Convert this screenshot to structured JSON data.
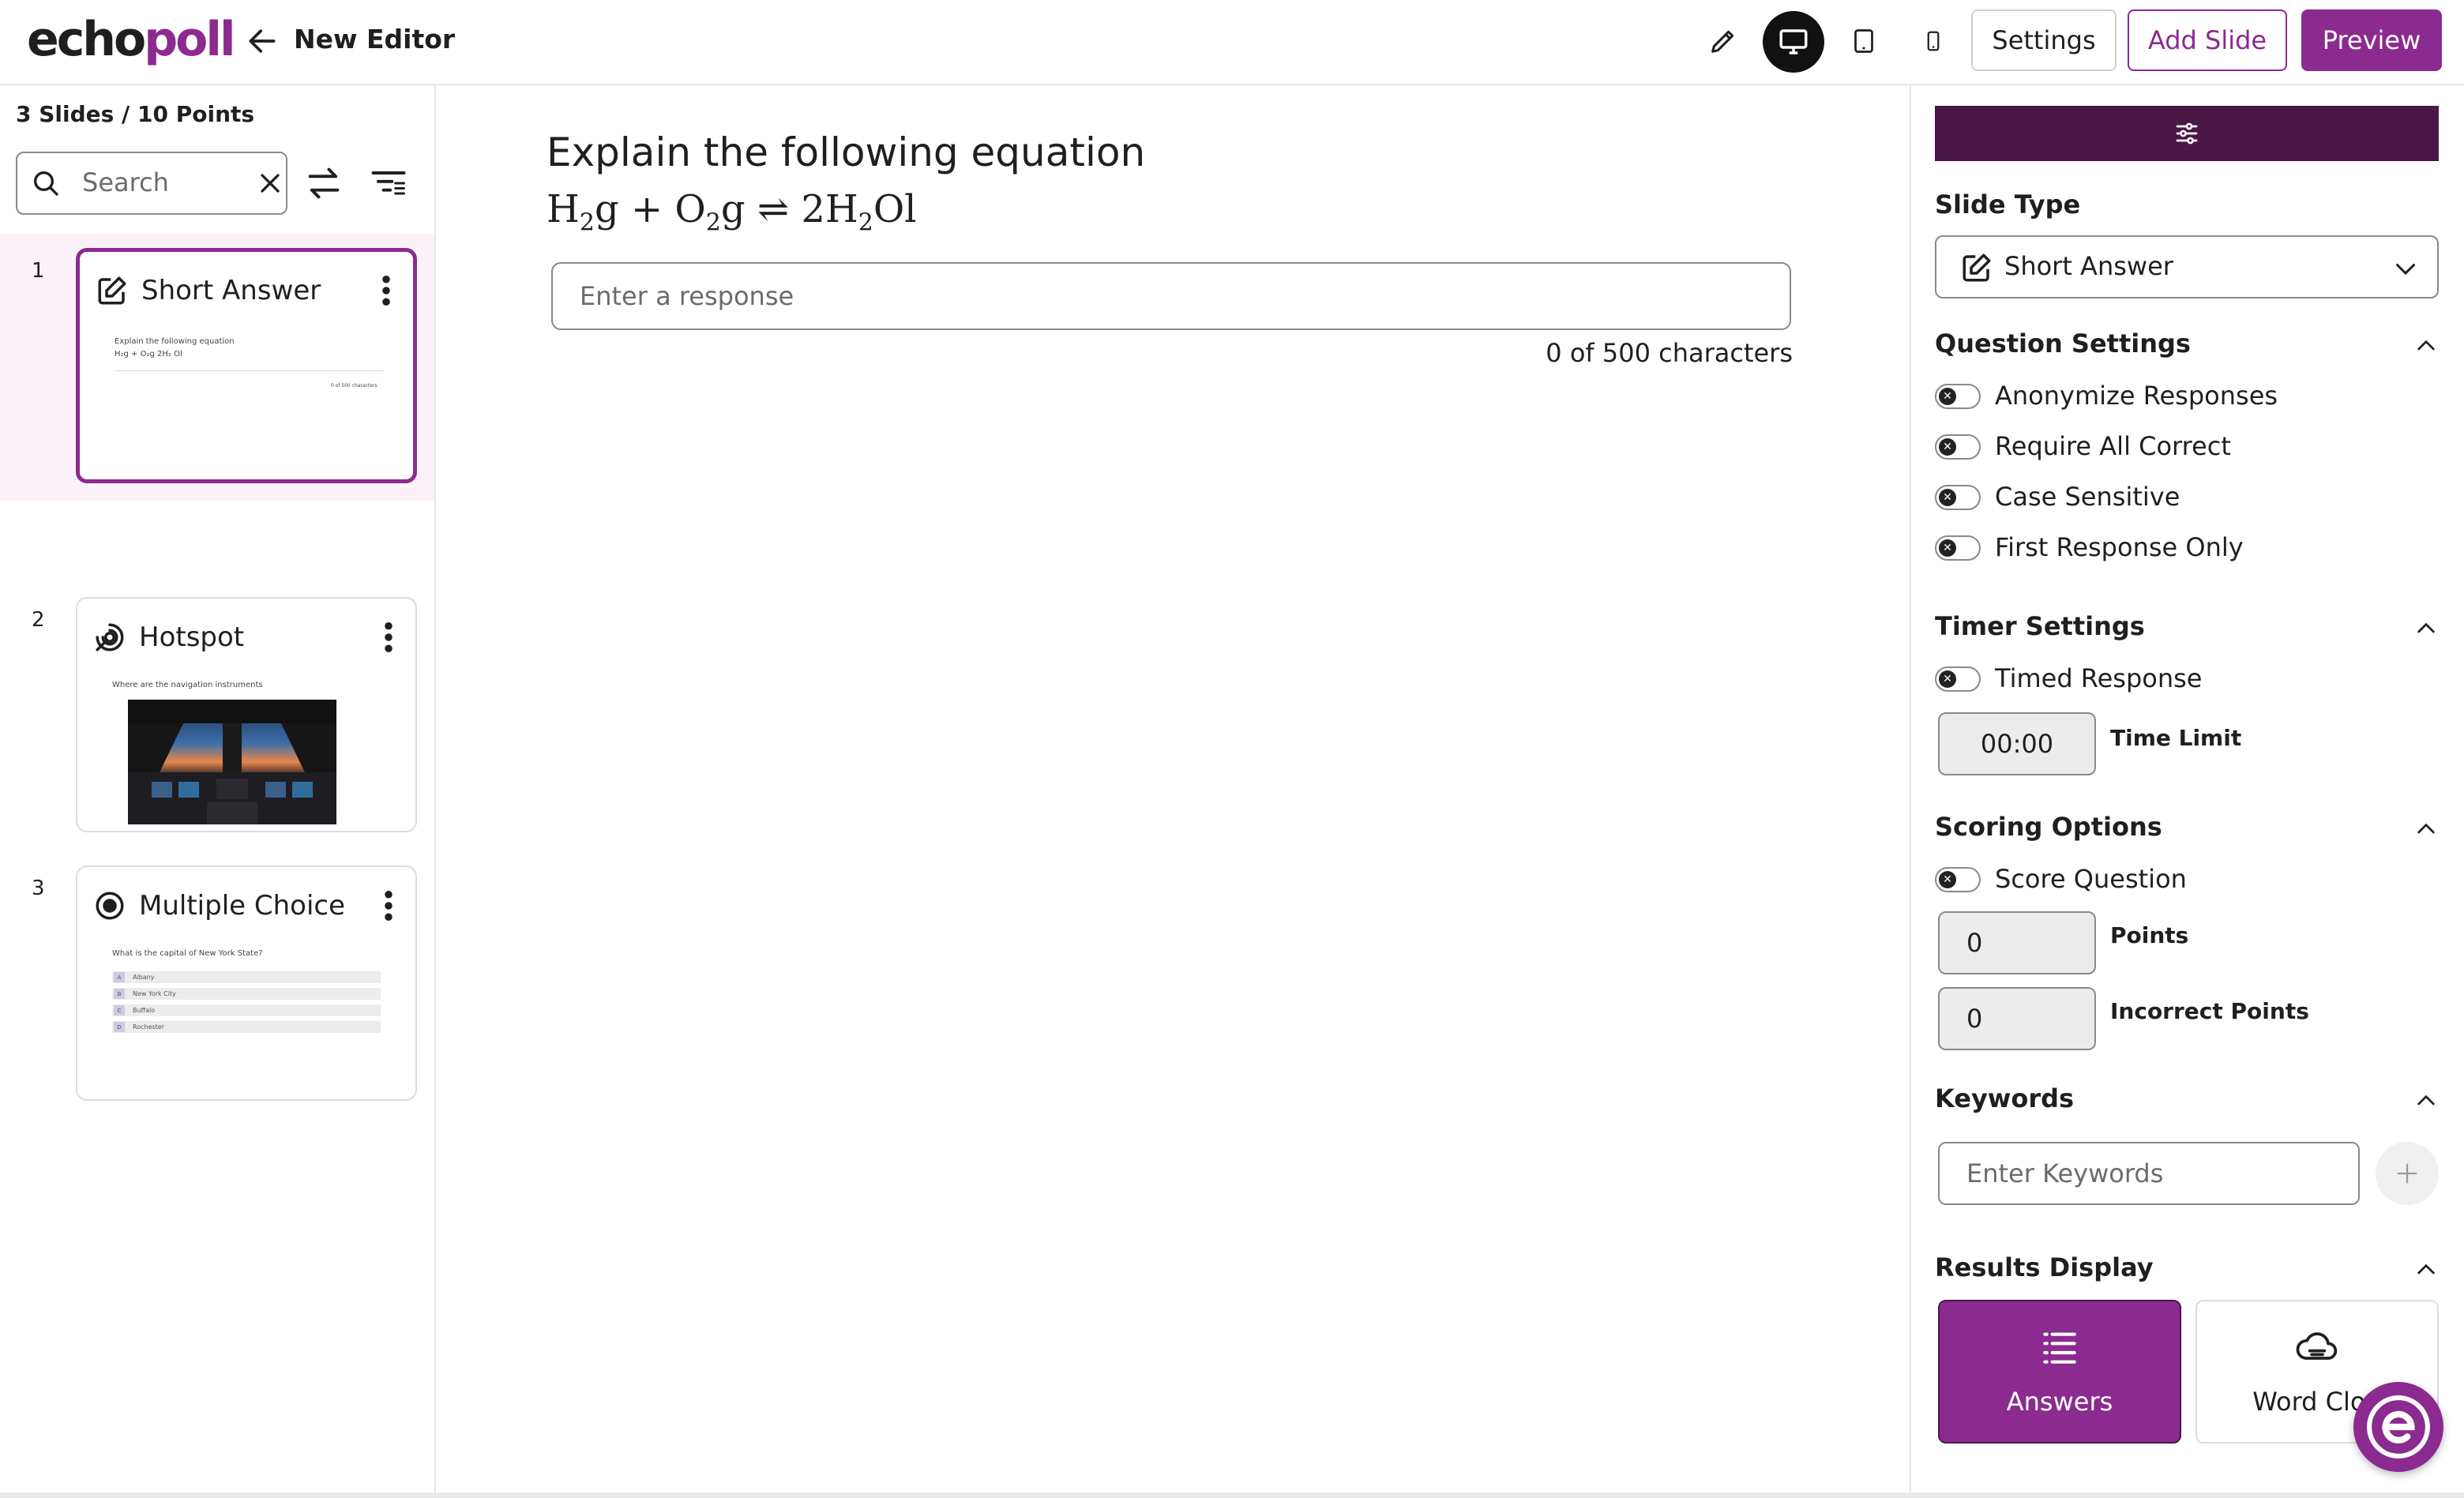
{
  "app": {
    "logo_part1": "echo",
    "logo_part2": "poll",
    "editor_title": "New Editor"
  },
  "toolbar": {
    "settings_label": "Settings",
    "add_slide_label": "Add Slide",
    "preview_label": "Preview",
    "icons": [
      "pencil-icon",
      "desktop-icon",
      "tablet-icon",
      "phone-icon"
    ]
  },
  "sidebar": {
    "summary": "3 Slides / 10 Points",
    "search": {
      "placeholder": "Search"
    },
    "slides": [
      {
        "number": "1",
        "title": "Short Answer",
        "icon": "edit-icon",
        "preview_question": "Explain the following equation",
        "preview_equation": "H₂g + O₂g    2H₂ Ol",
        "preview_count": "0 of 500 characters"
      },
      {
        "number": "2",
        "title": "Hotspot",
        "icon": "hotspot-icon",
        "preview_question": "Where are the navigation instruments"
      },
      {
        "number": "3",
        "title": "Multiple Choice",
        "icon": "radio-icon",
        "preview_question": "What is the capital of New York State?",
        "preview_options": [
          {
            "key": "A",
            "text": "Albany"
          },
          {
            "key": "B",
            "text": "New York City"
          },
          {
            "key": "C",
            "text": "Buffalo"
          },
          {
            "key": "D",
            "text": "Rochester"
          }
        ]
      }
    ]
  },
  "main": {
    "question_title": "Explain the following equation",
    "equation": {
      "h": "H",
      "sub2": "2",
      "g1": "g + O",
      "sub2b": "2",
      "g2": "g ",
      "arrow": "⇌",
      "rhs1": " 2H",
      "sub2c": "2",
      "rhs2": "Ol"
    },
    "response_placeholder": "Enter a response",
    "char_count": "0 of 500 characters"
  },
  "panel": {
    "slide_type_label": "Slide Type",
    "slide_type_value": "Short Answer",
    "question_settings": {
      "title": "Question Settings",
      "toggles": [
        "Anonymize Responses",
        "Require All Correct",
        "Case Sensitive",
        "First Response Only"
      ]
    },
    "timer_settings": {
      "title": "Timer Settings",
      "toggle": "Timed Response",
      "time_value": "00:00",
      "time_label": "Time Limit"
    },
    "scoring": {
      "title": "Scoring Options",
      "toggle": "Score Question",
      "points_value": "0",
      "points_label": "Points",
      "incorrect_value": "0",
      "incorrect_label": "Incorrect Points"
    },
    "keywords": {
      "title": "Keywords",
      "placeholder": "Enter Keywords"
    },
    "results_display": {
      "title": "Results Display",
      "answers_label": "Answers",
      "cloud_label": "Word Clou"
    }
  },
  "colors": {
    "brand": "#8b2a8f",
    "banner": "#4a1747"
  }
}
